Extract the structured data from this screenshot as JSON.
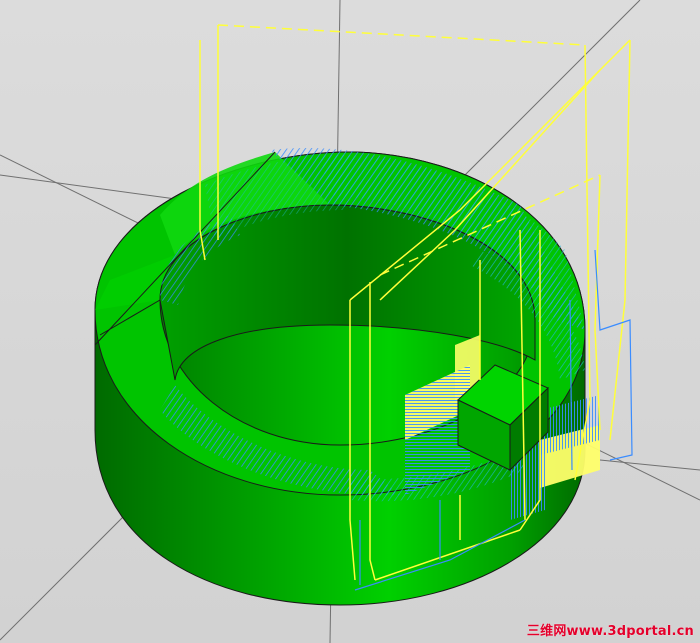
{
  "viewport": {
    "label": "",
    "watermark": "三维网www.3dportal.cn"
  },
  "colors": {
    "background": "#d6d6d6",
    "part_green": "#00b400",
    "part_green_dark": "#007a00",
    "toolpath_blue": "#3a8cff",
    "toolpath_cyan": "#00c8c8",
    "toolpath_yellow": "#ffff3a",
    "axis_line": "#6e6e6e"
  },
  "scene": {
    "part": "ring-with-block",
    "toolpath_style": "hatched-offset",
    "axes_visible": true
  }
}
